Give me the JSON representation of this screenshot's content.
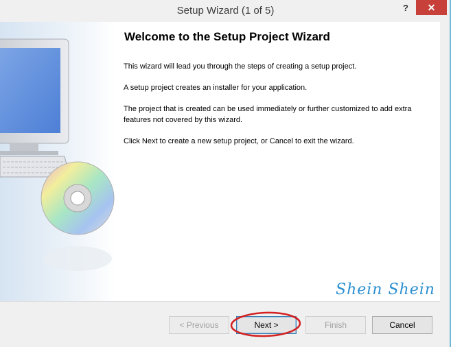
{
  "window": {
    "title": "Setup Wizard (1 of 5)",
    "help_label": "?",
    "close_label": "✕"
  },
  "page": {
    "heading": "Welcome to the Setup Project Wizard",
    "paragraphs": [
      "This wizard will lead you through the steps of creating a setup project.",
      "A setup project creates an installer for your application.",
      "The project that is created can be used immediately or further customized to add extra features not covered by this wizard.",
      "Click Next to create a new setup project, or Cancel to exit the wizard."
    ],
    "watermark": "Shein Shein"
  },
  "buttons": {
    "previous": "< Previous",
    "next": "Next >",
    "finish": "Finish",
    "cancel": "Cancel"
  },
  "colors": {
    "close": "#c7403a",
    "annotation": "#d42020",
    "watermark": "#2a8fd0"
  },
  "icons": {
    "artwork": [
      "computer-monitor-icon",
      "keyboard-icon",
      "cd-disc-icon"
    ]
  }
}
